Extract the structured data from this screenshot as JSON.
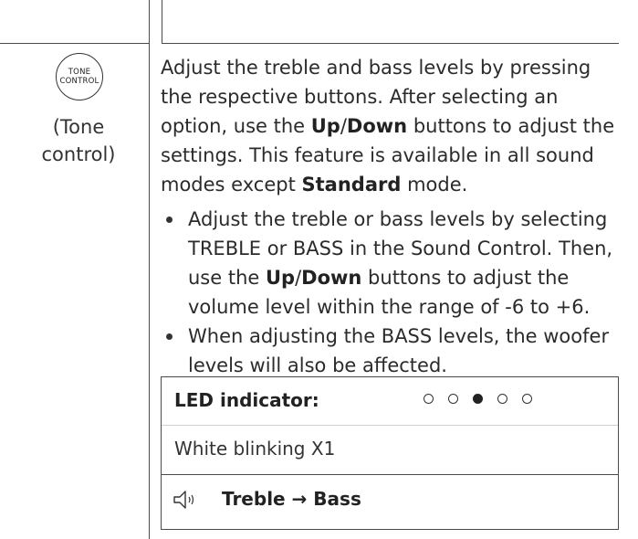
{
  "badge": {
    "line1": "TONE",
    "line2": "CONTROL",
    "caption": "(Tone control)"
  },
  "description": {
    "p1": "Adjust the treble and bass levels by pressing the respective buttons. After selecting an option, use the ",
    "up": "Up",
    "slash": "/",
    "down": "Down",
    "p2": " buttons to adjust the settings. This feature is available in all sound modes except ",
    "standard": "Standard",
    "p3": " mode."
  },
  "bullets": [
    {
      "a": "Adjust the treble or bass levels by selecting TREBLE or BASS in the Sound Control. Then, use the ",
      "up": "Up",
      "slash": "/",
      "down": "Down",
      "b": " buttons to adjust the volume level within the range of -6 to +6."
    },
    {
      "text": "When adjusting the BASS levels, the woofer levels will also be affected."
    }
  ],
  "led": {
    "label": "LED indicator:",
    "pattern": [
      false,
      false,
      true,
      false,
      false
    ],
    "status": "White blinking X1",
    "sequence": "Treble → Bass"
  },
  "icons": {
    "speaker": "speaker-sound-icon"
  }
}
